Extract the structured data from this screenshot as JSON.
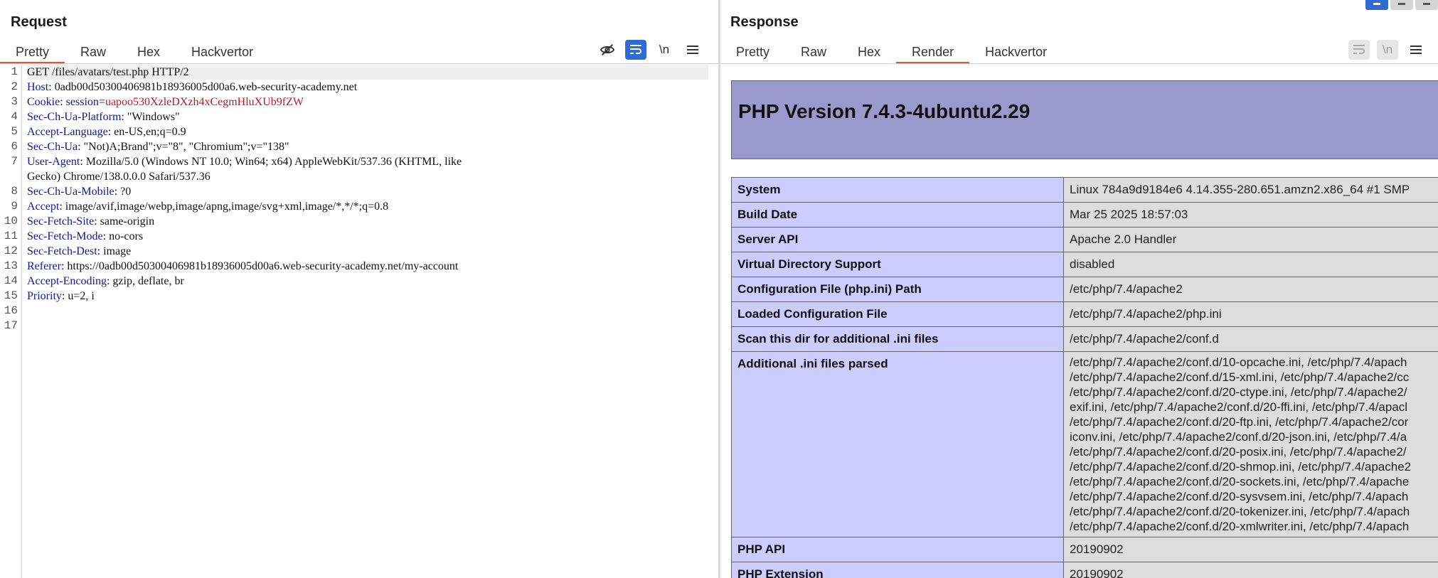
{
  "request": {
    "title": "Request",
    "tabs": [
      "Pretty",
      "Raw",
      "Hex",
      "Hackvertor"
    ],
    "active_tab": "Pretty",
    "toolbar": {
      "hide_icon": "eye-slash-icon",
      "wrap_icon": "word-wrap-icon",
      "newline_label": "\\n",
      "menu_icon": "hamburger-menu-icon"
    },
    "lines": [
      {
        "n": "1",
        "text": "GET /files/avatars/test.php HTTP/2"
      },
      {
        "n": "2",
        "name": "Host",
        "value": " 0adb00d50300406981b18936005d00a6.web-security-academy.net"
      },
      {
        "n": "3",
        "name": "Cookie",
        "cookie_key": " session",
        "cookie_eq": "=",
        "cookie_value": "uapoo530XzleDXzh4xCegmHluXUb9fZW"
      },
      {
        "n": "4",
        "name": "Sec-Ch-Ua-Platform",
        "value": " \"Windows\""
      },
      {
        "n": "5",
        "name": "Accept-Language",
        "value": " en-US,en;q=0.9"
      },
      {
        "n": "6",
        "name": "Sec-Ch-Ua",
        "value": " \"Not)A;Brand\";v=\"8\", \"Chromium\";v=\"138\""
      },
      {
        "n": "7",
        "name": "User-Agent",
        "value": " Mozilla/5.0 (Windows NT 10.0; Win64; x64) AppleWebKit/537.36 (KHTML, like",
        "cont": "Gecko) Chrome/138.0.0.0 Safari/537.36"
      },
      {
        "n": "8",
        "name": "Sec-Ch-Ua-Mobile",
        "value": " ?0"
      },
      {
        "n": "9",
        "name": "Accept",
        "value": " image/avif,image/webp,image/apng,image/svg+xml,image/*,*/*;q=0.8"
      },
      {
        "n": "10",
        "name": "Sec-Fetch-Site",
        "value": " same-origin"
      },
      {
        "n": "11",
        "name": "Sec-Fetch-Mode",
        "value": " no-cors"
      },
      {
        "n": "12",
        "name": "Sec-Fetch-Dest",
        "value": " image"
      },
      {
        "n": "13",
        "name": "Referer",
        "value": " https://0adb00d50300406981b18936005d00a6.web-security-academy.net/my-account"
      },
      {
        "n": "14",
        "name": "Accept-Encoding",
        "value": " gzip, deflate, br"
      },
      {
        "n": "15",
        "name": "Priority",
        "value": " u=2, i"
      },
      {
        "n": "16",
        "text": ""
      },
      {
        "n": "17",
        "text": ""
      }
    ]
  },
  "response": {
    "title": "Response",
    "tabs": [
      "Pretty",
      "Raw",
      "Hex",
      "Render",
      "Hackvertor"
    ],
    "active_tab": "Render",
    "toolbar": {
      "wrap_icon": "word-wrap-icon",
      "newline_label": "\\n",
      "menu_icon": "hamburger-menu-icon"
    },
    "render": {
      "heading": "PHP Version 7.4.3-4ubuntu2.29",
      "rows": [
        {
          "key": "System",
          "value": "Linux 784a9d9184e6 4.14.355-280.651.amzn2.x86_64 #1 SMP"
        },
        {
          "key": "Build Date",
          "value": "Mar 25 2025 18:57:03"
        },
        {
          "key": "Server API",
          "value": "Apache 2.0 Handler"
        },
        {
          "key": "Virtual Directory Support",
          "value": "disabled"
        },
        {
          "key": "Configuration File (php.ini) Path",
          "value": "/etc/php/7.4/apache2"
        },
        {
          "key": "Loaded Configuration File",
          "value": "/etc/php/7.4/apache2/php.ini"
        },
        {
          "key": "Scan this dir for additional .ini files",
          "value": "/etc/php/7.4/apache2/conf.d"
        },
        {
          "key": "Additional .ini files parsed",
          "lines": [
            "/etc/php/7.4/apache2/conf.d/10-opcache.ini, /etc/php/7.4/apach",
            "/etc/php/7.4/apache2/conf.d/15-xml.ini, /etc/php/7.4/apache2/cc",
            "/etc/php/7.4/apache2/conf.d/20-ctype.ini, /etc/php/7.4/apache2/",
            "exif.ini, /etc/php/7.4/apache2/conf.d/20-ffi.ini, /etc/php/7.4/apacl",
            "/etc/php/7.4/apache2/conf.d/20-ftp.ini, /etc/php/7.4/apache2/cor",
            "iconv.ini, /etc/php/7.4/apache2/conf.d/20-json.ini, /etc/php/7.4/a",
            "/etc/php/7.4/apache2/conf.d/20-posix.ini, /etc/php/7.4/apache2/",
            "/etc/php/7.4/apache2/conf.d/20-shmop.ini, /etc/php/7.4/apache2",
            "/etc/php/7.4/apache2/conf.d/20-sockets.ini, /etc/php/7.4/apache",
            "/etc/php/7.4/apache2/conf.d/20-sysvsem.ini, /etc/php/7.4/apach",
            "/etc/php/7.4/apache2/conf.d/20-tokenizer.ini, /etc/php/7.4/apach",
            "/etc/php/7.4/apache2/conf.d/20-xmlwriter.ini, /etc/php/7.4/apach"
          ]
        },
        {
          "key": "PHP API",
          "value": "20190902"
        },
        {
          "key": "PHP Extension",
          "value": "20190902"
        }
      ]
    },
    "colors": {
      "header_bg": "#9999cc",
      "key_bg": "#ccccff",
      "value_bg": "#dddddd"
    }
  },
  "layout_buttons": [
    "split-horizontal-icon",
    "split-vertical-icon",
    "single-pane-icon"
  ],
  "accent_color": "#e8542f",
  "button_blue": "#2f6bd4"
}
